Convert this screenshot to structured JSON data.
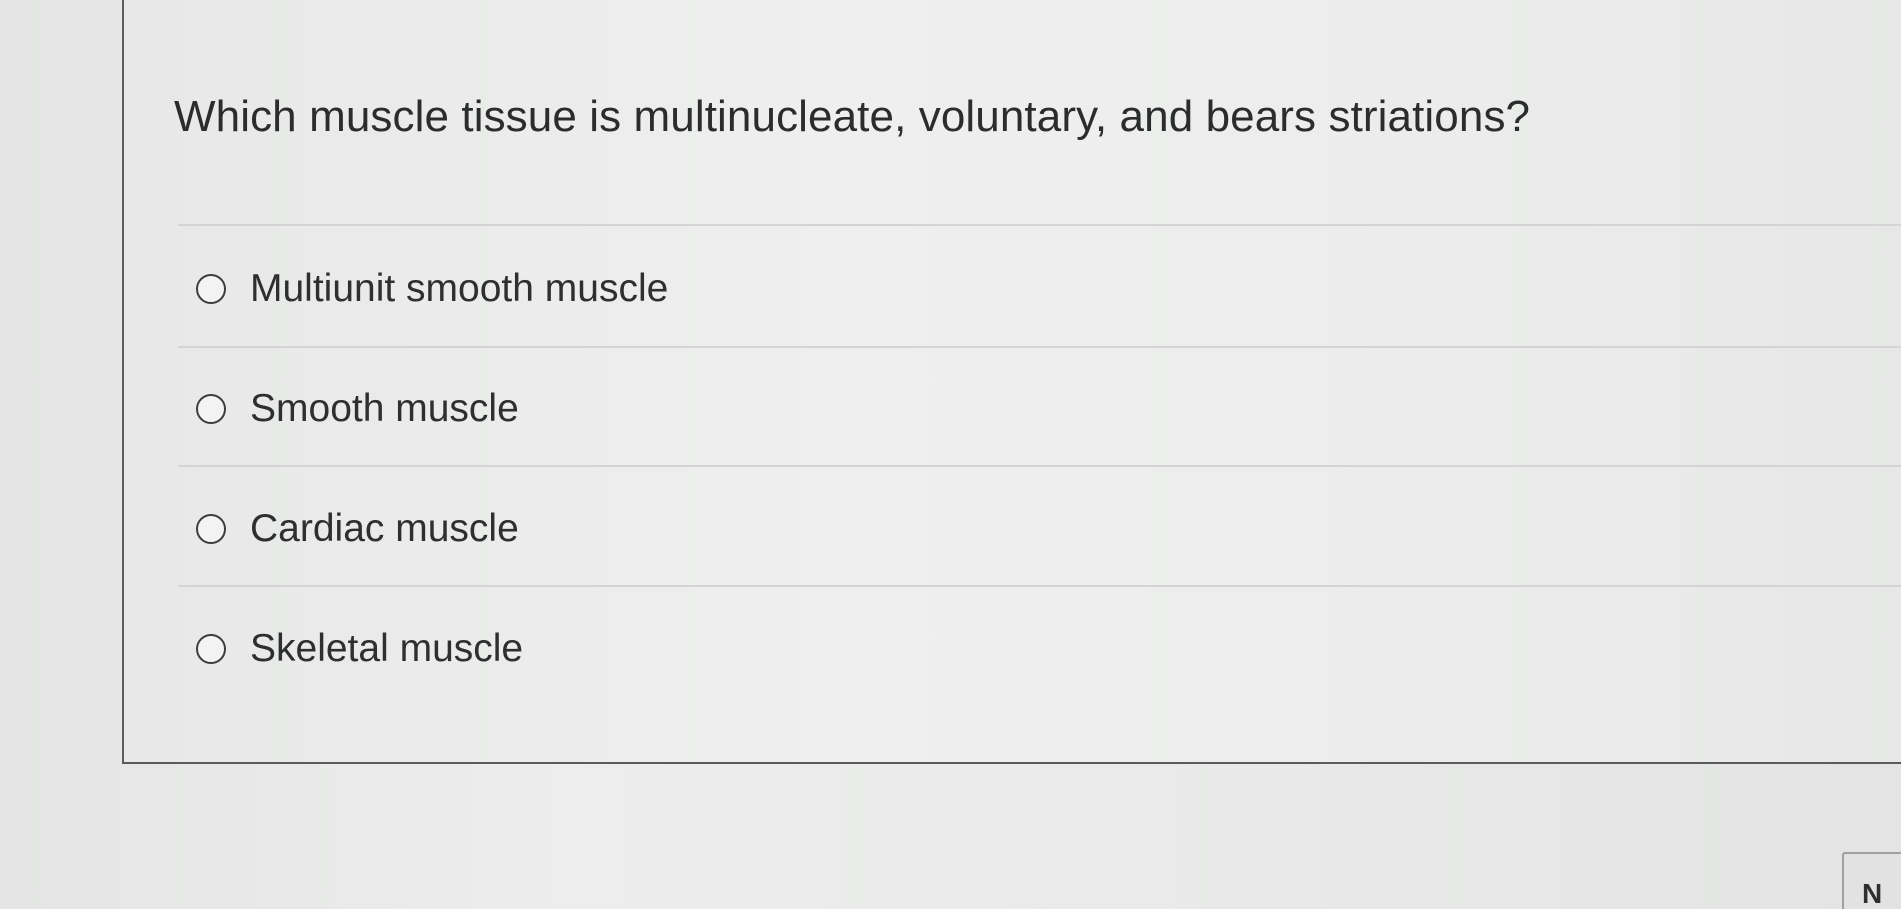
{
  "question": {
    "text": "Which muscle tissue is multinucleate, voluntary, and bears striations?"
  },
  "options": [
    {
      "label": "Multiunit smooth muscle",
      "selected": false
    },
    {
      "label": "Smooth muscle",
      "selected": false
    },
    {
      "label": "Cardiac muscle",
      "selected": false
    },
    {
      "label": "Skeletal muscle",
      "selected": false
    }
  ],
  "corner_button": {
    "glyph": "N"
  }
}
